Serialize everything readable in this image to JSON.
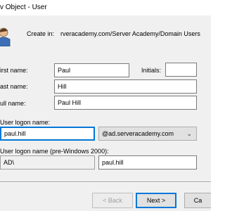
{
  "window": {
    "title": "v Object - User"
  },
  "header": {
    "create_in_label": "Create in:",
    "create_in_path": "rveracademy.com/Server Academy/Domain Users"
  },
  "form": {
    "first_name_label": "irst name:",
    "first_name_value": "Paul",
    "initials_label": "Initials:",
    "initials_value": "",
    "last_name_label": "ast name:",
    "last_name_value": "Hill",
    "full_name_label": "ull name:",
    "full_name_value": "Paul Hill",
    "logon_name_label": "User logon name:",
    "logon_name_value": "paul.hill",
    "domain_suffix_selected": "@ad.serveracademy.com",
    "pre2000_label": "User logon name (pre-Windows 2000):",
    "pre2000_domain": "AD\\",
    "pre2000_value": "paul.hill"
  },
  "buttons": {
    "back": "< Back",
    "next": "Next >",
    "cancel": "Ca"
  },
  "icons": {
    "user": "user-icon",
    "dropdown": "chevron-down-icon"
  }
}
